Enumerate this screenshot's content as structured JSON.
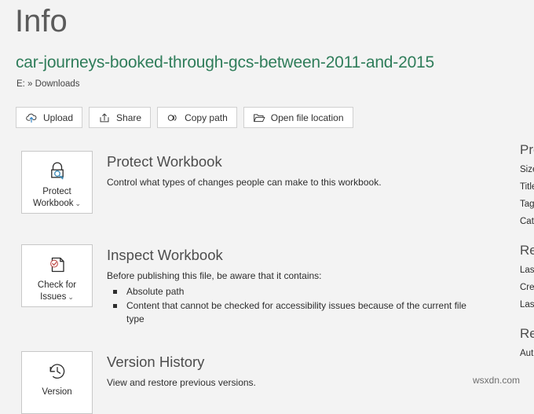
{
  "page": {
    "title": "Info",
    "file_name": "car-journeys-booked-through-gcs-between-2011-and-2015",
    "file_path": "E: » Downloads"
  },
  "commands": [
    {
      "label": "Upload",
      "icon": "cloud-upload-icon"
    },
    {
      "label": "Share",
      "icon": "share-icon"
    },
    {
      "label": "Copy path",
      "icon": "link-icon"
    },
    {
      "label": "Open file location",
      "icon": "folder-open-icon"
    }
  ],
  "sections": {
    "protect": {
      "button_line1": "Protect",
      "button_line2": "Workbook",
      "chevron": "⌄",
      "icon": "padlock-key-icon",
      "heading": "Protect Workbook",
      "description": "Control what types of changes people can make to this workbook."
    },
    "inspect": {
      "button_line1": "Check for",
      "button_line2": "Issues",
      "chevron": "⌄",
      "icon": "document-check-icon",
      "heading": "Inspect Workbook",
      "description": "Before publishing this file, be aware that it contains:",
      "items": [
        "Absolute path",
        "Content that cannot be checked for accessibility issues because of the current file type"
      ]
    },
    "version": {
      "button_line1": "Version",
      "button_line2": "",
      "icon": "clock-history-icon",
      "heading": "Version History",
      "description": "View and restore previous versions."
    }
  },
  "properties_pane": {
    "groups": [
      {
        "heading": "Properties",
        "rows": [
          "Size",
          "Title",
          "Tags",
          "Categories"
        ]
      },
      {
        "heading": "Related Dates",
        "rows": [
          "Last Modified",
          "Created",
          "Last Printed"
        ]
      },
      {
        "heading": "Related People",
        "rows": [
          "Author"
        ]
      }
    ]
  },
  "watermark": "wsxdn.com",
  "colors": {
    "background": "#f3f3f3",
    "accent_green": "#2f7d5a",
    "icon_blue": "#3b8bb8",
    "icon_red": "#c0504d",
    "title_gray": "#5b5b5b"
  }
}
